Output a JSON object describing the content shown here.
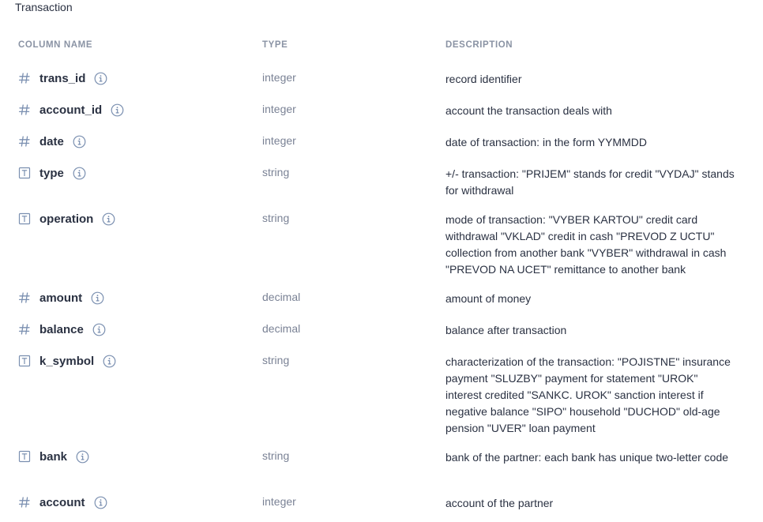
{
  "table": {
    "title": "Transaction"
  },
  "headers": {
    "name": "COLUMN NAME",
    "type": "TYPE",
    "description": "DESCRIPTION"
  },
  "icons": {
    "numeric": "hash-icon",
    "text": "text-type-icon",
    "info": "info-icon"
  },
  "colors": {
    "icon": "#7a8fb0",
    "header": "#8a93a4",
    "type_text": "#7a8295"
  },
  "columns": [
    {
      "name": "trans_id",
      "type": "integer",
      "kind": "numeric",
      "description": "record identifier"
    },
    {
      "name": "account_id",
      "type": "integer",
      "kind": "numeric",
      "description": "account the transaction deals with"
    },
    {
      "name": "date",
      "type": "integer",
      "kind": "numeric",
      "description": "date of transaction: in the form YYMMDD"
    },
    {
      "name": "type",
      "type": "string",
      "kind": "text",
      "description": "+/- transaction: \"PRIJEM\" stands for credit \"VYDAJ\" stands for withdrawal"
    },
    {
      "name": "operation",
      "type": "string",
      "kind": "text",
      "description": "mode of transaction: \"VYBER KARTOU\" credit card withdrawal \"VKLAD\" credit in cash \"PREVOD Z UCTU\" collection from another bank \"VYBER\" withdrawal in cash \"PREVOD NA UCET\" remittance to another bank"
    },
    {
      "name": "amount",
      "type": "decimal",
      "kind": "numeric",
      "description": "amount of money"
    },
    {
      "name": "balance",
      "type": "decimal",
      "kind": "numeric",
      "description": "balance after transaction"
    },
    {
      "name": "k_symbol",
      "type": "string",
      "kind": "text",
      "description": "characterization of the transaction: \"POJISTNE\" insurance payment \"SLUZBY\" payment for statement \"UROK\" interest credited \"SANKC. UROK\" sanction interest if negative balance \"SIPO\" household \"DUCHOD\" old-age pension \"UVER\" loan payment"
    },
    {
      "name": "bank",
      "type": "string",
      "kind": "text",
      "description": "bank of the partner: each bank has unique two-letter code"
    },
    {
      "name": "account",
      "type": "integer",
      "kind": "numeric",
      "description": "account of the partner"
    }
  ]
}
